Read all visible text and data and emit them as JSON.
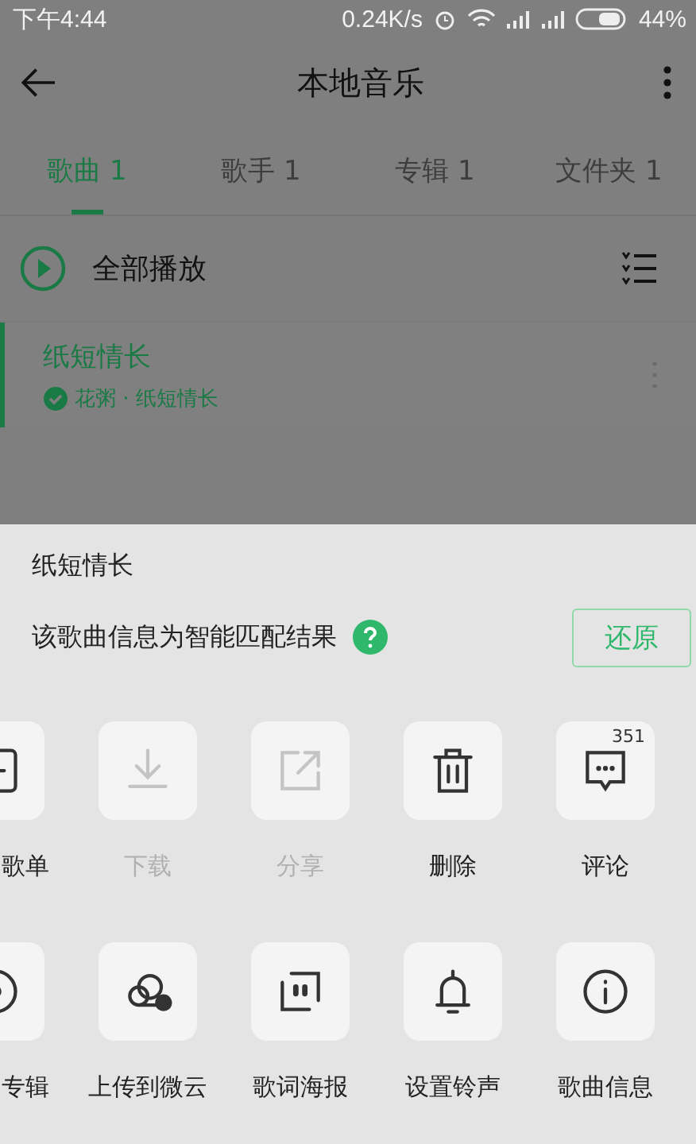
{
  "status_bar": {
    "time": "下午4:44",
    "speed": "0.24K/s",
    "battery": "44%"
  },
  "header": {
    "title": "本地音乐"
  },
  "tabs": [
    {
      "label": "歌曲 1",
      "selected": true
    },
    {
      "label": "歌手 1",
      "selected": false
    },
    {
      "label": "专辑 1",
      "selected": false
    },
    {
      "label": "文件夹 1",
      "selected": false
    }
  ],
  "play_all": {
    "label": "全部播放"
  },
  "songs": [
    {
      "title": "纸短情长",
      "subtitle": "花粥 · 纸短情长",
      "playing": true
    }
  ],
  "sheet": {
    "title": "纸短情长",
    "info": "该歌曲信息为智能匹配结果",
    "restore_button": "还原",
    "actions": [
      {
        "label": "歌单",
        "disabled": false
      },
      {
        "label": "下载",
        "disabled": true
      },
      {
        "label": "分享",
        "disabled": true
      },
      {
        "label": "删除",
        "disabled": false
      },
      {
        "label": "评论",
        "disabled": false,
        "badge": "351"
      },
      {
        "label": "专辑",
        "disabled": false
      },
      {
        "label": "上传到微云",
        "disabled": false
      },
      {
        "label": "歌词海报",
        "disabled": false
      },
      {
        "label": "设置铃声",
        "disabled": false
      },
      {
        "label": "歌曲信息",
        "disabled": false
      }
    ]
  }
}
